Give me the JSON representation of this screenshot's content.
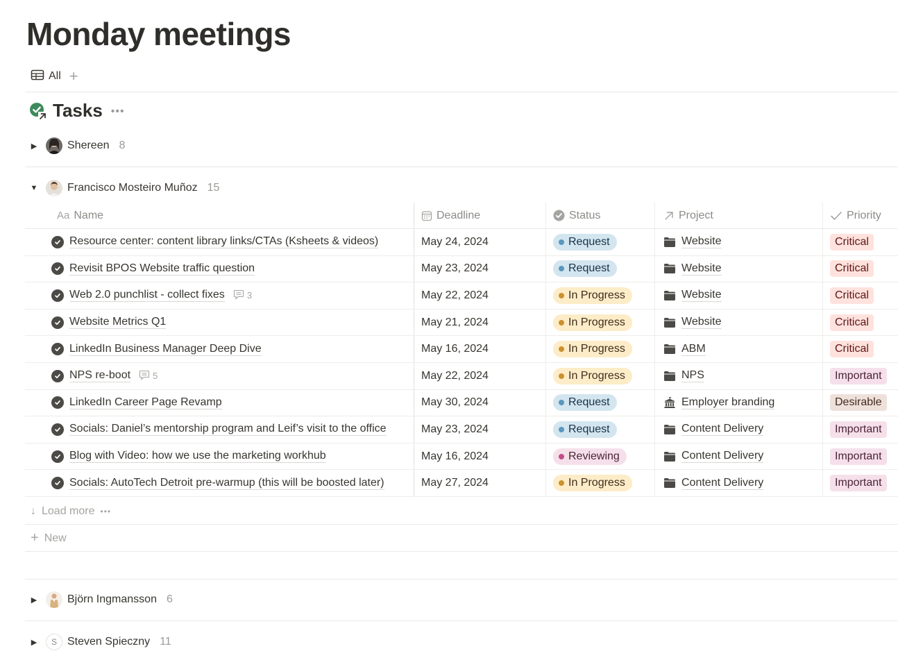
{
  "page": {
    "title": "Monday meetings"
  },
  "views": {
    "tabs": [
      {
        "label": "All",
        "icon": "table-icon"
      }
    ],
    "add_label": "+"
  },
  "database": {
    "title": "Tasks",
    "icon": "linked-check-circle-icon",
    "more": "•••"
  },
  "groups": [
    {
      "name": "Shereen",
      "count": "8",
      "expanded": false
    },
    {
      "name": "Francisco Mosteiro Muñoz",
      "count": "15",
      "expanded": true
    },
    {
      "name": "Björn Ingmansson",
      "count": "6",
      "expanded": false
    },
    {
      "name": "Steven Spieczny",
      "count": "11",
      "expanded": false,
      "initial": "S"
    }
  ],
  "columns": {
    "name": {
      "label": "Name",
      "icon": "Aa"
    },
    "deadline": {
      "label": "Deadline",
      "icon": "calendar-icon"
    },
    "status": {
      "label": "Status",
      "icon": "status-icon"
    },
    "project": {
      "label": "Project",
      "icon": "relation-arrow-icon"
    },
    "priority": {
      "label": "Priority",
      "icon": "select-check-icon"
    }
  },
  "status_colors": {
    "Request": {
      "bg": "#d3e5ef",
      "dot": "#5a97bd",
      "fg": "#183347"
    },
    "In Progress": {
      "bg": "#fdecc8",
      "dot": "#cb912f",
      "fg": "#402c1b"
    },
    "Reviewing": {
      "bg": "#f5e0e9",
      "dot": "#c14c8a",
      "fg": "#4c2337"
    }
  },
  "priority_colors": {
    "Critical": {
      "bg": "#ffe2dd",
      "fg": "#5d1715"
    },
    "Important": {
      "bg": "#f5e0e9",
      "fg": "#4c2337"
    },
    "Desirable": {
      "bg": "#eee0da",
      "fg": "#442a1e"
    }
  },
  "rows": [
    {
      "name": "Resource center: content library links/CTAs (Ksheets & videos)",
      "comments": "",
      "deadline": "May 24, 2024",
      "status": "Request",
      "project": "Website",
      "project_icon": "folder",
      "priority": "Critical"
    },
    {
      "name": "Revisit BPOS Website traffic question",
      "comments": "",
      "deadline": "May 23, 2024",
      "status": "Request",
      "project": "Website",
      "project_icon": "folder",
      "priority": "Critical"
    },
    {
      "name": "Web 2.0 punchlist - collect fixes",
      "comments": "3",
      "deadline": "May 22, 2024",
      "status": "In Progress",
      "project": "Website",
      "project_icon": "folder",
      "priority": "Critical"
    },
    {
      "name": "Website Metrics Q1",
      "comments": "",
      "deadline": "May 21, 2024",
      "status": "In Progress",
      "project": "Website",
      "project_icon": "folder",
      "priority": "Critical"
    },
    {
      "name": "LinkedIn Business Manager Deep Dive",
      "comments": "",
      "deadline": "May 16, 2024",
      "status": "In Progress",
      "project": "ABM",
      "project_icon": "folder",
      "priority": "Critical"
    },
    {
      "name": "NPS re-boot",
      "comments": "5",
      "deadline": "May 22, 2024",
      "status": "In Progress",
      "project": "NPS",
      "project_icon": "folder",
      "priority": "Important"
    },
    {
      "name": "LinkedIn Career Page Revamp",
      "comments": "",
      "deadline": "May 30, 2024",
      "status": "Request",
      "project": "Employer branding",
      "project_icon": "building",
      "priority": "Desirable"
    },
    {
      "name": "Socials: Daniel’s mentorship program and Leif’s visit to the office",
      "comments": "",
      "deadline": "May 23, 2024",
      "status": "Request",
      "project": "Content Delivery",
      "project_icon": "folder",
      "priority": "Important"
    },
    {
      "name": "Blog with Video: how we use the marketing workhub",
      "comments": "",
      "deadline": "May 16, 2024",
      "status": "Reviewing",
      "project": "Content Delivery",
      "project_icon": "folder",
      "priority": "Important"
    },
    {
      "name": "Socials: AutoTech Detroit pre-warmup (this will be boosted later)",
      "comments": "",
      "deadline": "May 27, 2024",
      "status": "In Progress",
      "project": "Content Delivery",
      "project_icon": "folder",
      "priority": "Important"
    }
  ],
  "footer": {
    "load_more": "Load more",
    "load_more_dots": "•••",
    "new_label": "New"
  }
}
